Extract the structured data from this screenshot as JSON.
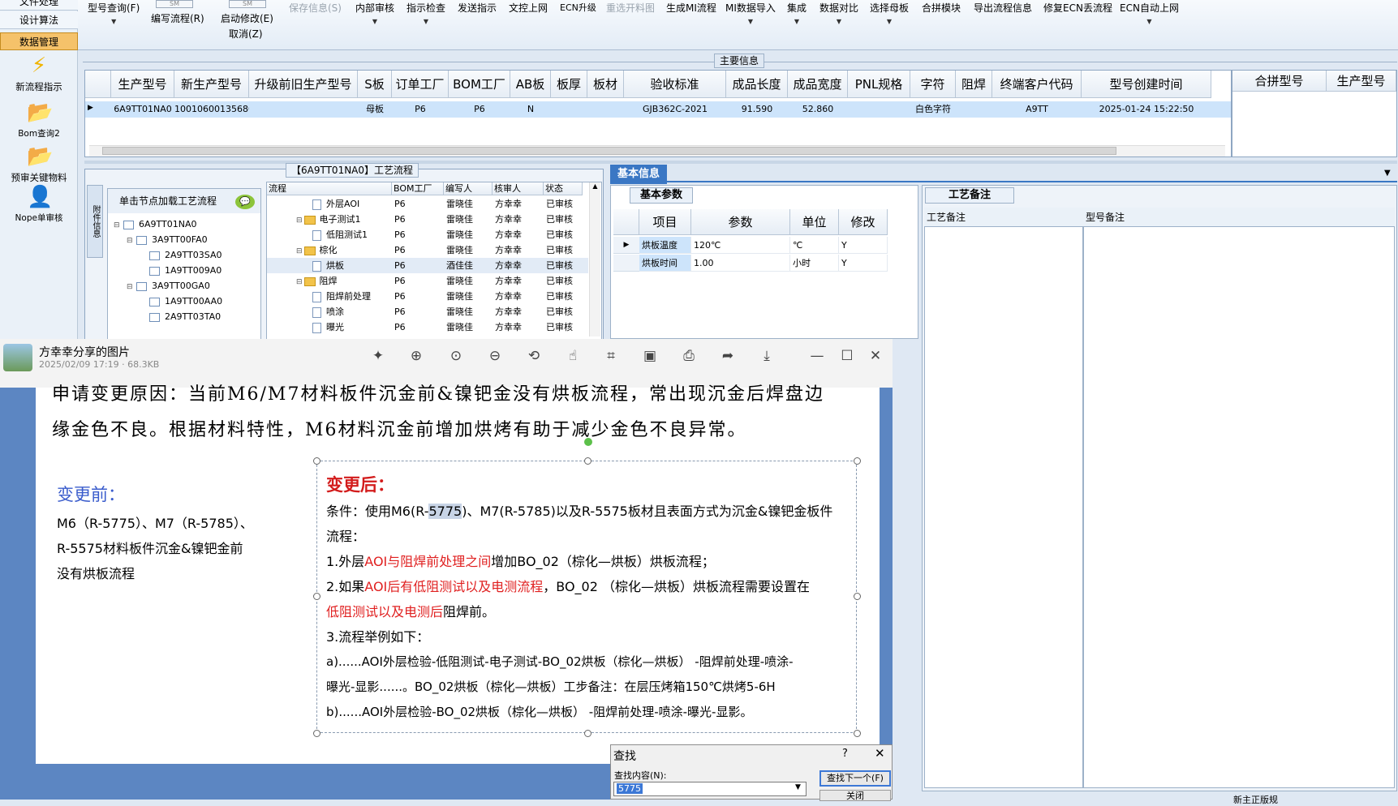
{
  "sidebar": {
    "menus": [
      "文件处理",
      "设计算法",
      "数据管理"
    ],
    "tools": [
      {
        "label": "新流程指示",
        "icon": "lightning-icon"
      },
      {
        "label": "Bom查询2",
        "icon": "folder-icon"
      },
      {
        "label": "预审关键物料",
        "icon": "folder-icon"
      },
      {
        "label": "Nope单审核",
        "icon": "user-icon"
      }
    ]
  },
  "toolbar": {
    "items": [
      "型号查询(F)",
      "编写流程(R)",
      "启动修改(E)",
      "取消(Z)",
      "保存信息(S)",
      "内部审核",
      "指示检查",
      "发送指示",
      "文控上网",
      "ECN升级",
      "重选开料图",
      "生成MI流程",
      "MI数据导入",
      "集成",
      "数据对比",
      "选择母板",
      "合拼模块",
      "导出流程信息",
      "修复ECN丢流程",
      "ECN自动上网"
    ],
    "mini1": "SM",
    "mini2": "SM"
  },
  "main_info": {
    "group_label": "主要信息",
    "headers": [
      "生产型号",
      "新生产型号",
      "升级前旧生产型号",
      "S板",
      "订单工厂",
      "BOM工厂",
      "AB板",
      "板厚",
      "板材",
      "验收标准",
      "成品长度",
      "成品宽度",
      "PNL规格",
      "字符",
      "阻焊",
      "终端客户代码",
      "型号创建时间"
    ],
    "row": [
      "6A9TT01NA0",
      "10010600135680",
      "",
      "母板",
      "P6",
      "P6",
      "N",
      "",
      "",
      "GJB362C-2021",
      "91.590",
      "52.860",
      "",
      "白色字符",
      "",
      "A9TT",
      "2025-01-24 15:22:50"
    ],
    "side_headers": [
      "合拼型号",
      "生产型号"
    ]
  },
  "process": {
    "title": "【6A9TT01NA0】工艺流程",
    "side_tab": "附件信息",
    "tree_header": "单击节点加载工艺流程",
    "tree": [
      "6A9TT01NA0",
      "3A9TT00FA0",
      "2A9TT03SA0",
      "1A9TT009A0",
      "3A9TT00GA0",
      "1A9TT00AA0",
      "2A9TT03TA0"
    ],
    "grid_headers": [
      "流程",
      "BOM工厂",
      "编写人",
      "核审人",
      "状态"
    ],
    "rows": [
      {
        "name": "外层AOI",
        "type": "doc",
        "f": "P6",
        "w": "雷晓佳",
        "c": "方幸幸",
        "s": "已审核"
      },
      {
        "name": "电子测试1",
        "type": "folder",
        "f": "P6",
        "w": "雷晓佳",
        "c": "方幸幸",
        "s": "已审核"
      },
      {
        "name": "低阻测试1",
        "type": "doc",
        "f": "P6",
        "w": "雷晓佳",
        "c": "方幸幸",
        "s": "已审核"
      },
      {
        "name": "棕化",
        "type": "folder",
        "f": "P6",
        "w": "雷晓佳",
        "c": "方幸幸",
        "s": "已审核"
      },
      {
        "name": "烘板",
        "type": "doc",
        "f": "P6",
        "w": "酒佳佳",
        "c": "方幸幸",
        "s": "已审核"
      },
      {
        "name": "阻焊",
        "type": "folder",
        "f": "P6",
        "w": "雷晓佳",
        "c": "方幸幸",
        "s": "已审核"
      },
      {
        "name": "阻焊前处理",
        "type": "doc",
        "f": "P6",
        "w": "雷晓佳",
        "c": "方幸幸",
        "s": "已审核"
      },
      {
        "name": "喷涂",
        "type": "doc",
        "f": "P6",
        "w": "雷晓佳",
        "c": "方幸幸",
        "s": "已审核"
      },
      {
        "name": "曝光",
        "type": "doc",
        "f": "P6",
        "w": "雷晓佳",
        "c": "方幸幸",
        "s": "已审核"
      }
    ]
  },
  "basic_info": {
    "tab": "基本信息",
    "sub_tab": "基本参数",
    "headers": [
      "项目",
      "参数",
      "单位",
      "修改"
    ],
    "rows": [
      {
        "item": "烘板温度",
        "param": "120℃",
        "unit": "℃",
        "mod": "Y"
      },
      {
        "item": "烘板时间",
        "param": "1.00",
        "unit": "小时",
        "mod": "Y"
      }
    ]
  },
  "craft_note": {
    "tab": "工艺备注",
    "h1": "工艺备注",
    "h2": "型号备注"
  },
  "viewer": {
    "title": "方幸幸分享的图片",
    "meta": "2025/02/09 17:19 · 68.3KB",
    "doc": {
      "line1": "申请变更原因：当前M6/M7材料板件沉金前&镍钯金没有烘板流程，常出现沉金后焊盘边",
      "line2": "缘金色不良。根据材料特性，M6材料沉金前增加烘烤有助于减少金色不良异常。",
      "before_title": "变更前：",
      "before_lines": [
        "M6（R-5775）、M7（R-5785）、",
        "R-5575材料板件沉金&镍钯金前",
        "没有烘板流程"
      ],
      "after_title": "变更后：",
      "cond_a": "条件：使用M6(R-",
      "cond_hl": "5775",
      "cond_b": ")、M7(R-5785)以及R-5575板材且表面方式为沉金&镍钯金板件",
      "cond_2": "流程：",
      "l1_a": "1.外层",
      "l1_r": "AOI与阻焊前处理之间",
      "l1_b": "增加BO_02（棕化—烘板）烘板流程；",
      "l2_a": "2.如果",
      "l2_r": "AOI后有低阻测试以及电测流程",
      "l2_b": "，BO_02 （棕化—烘板）烘板流程需要设置在",
      "l2_r2": "低阻测试以及电测后",
      "l2_c": "阻焊前。",
      "l3": "3.流程举例如下：",
      "l4": "a)......AOI外层检验-低阻测试-电子测试-BO_02烘板（棕化—烘板） -阻焊前处理-喷涂-",
      "l5": "曝光-显影......。BO_02烘板（棕化—烘板）工步备注：在层压烤箱150℃烘烤5-6H",
      "l6": "b)......AOI外层检验-BO_02烘板（棕化—烘板） -阻焊前处理-喷涂-曝光-显影。"
    }
  },
  "find": {
    "title": "查找",
    "help": "?",
    "label": "查找内容(N):",
    "value": "5775",
    "next_btn": "查找下一个(F)",
    "close_btn": "关闭"
  },
  "status": {
    "right": "新主正版规"
  }
}
